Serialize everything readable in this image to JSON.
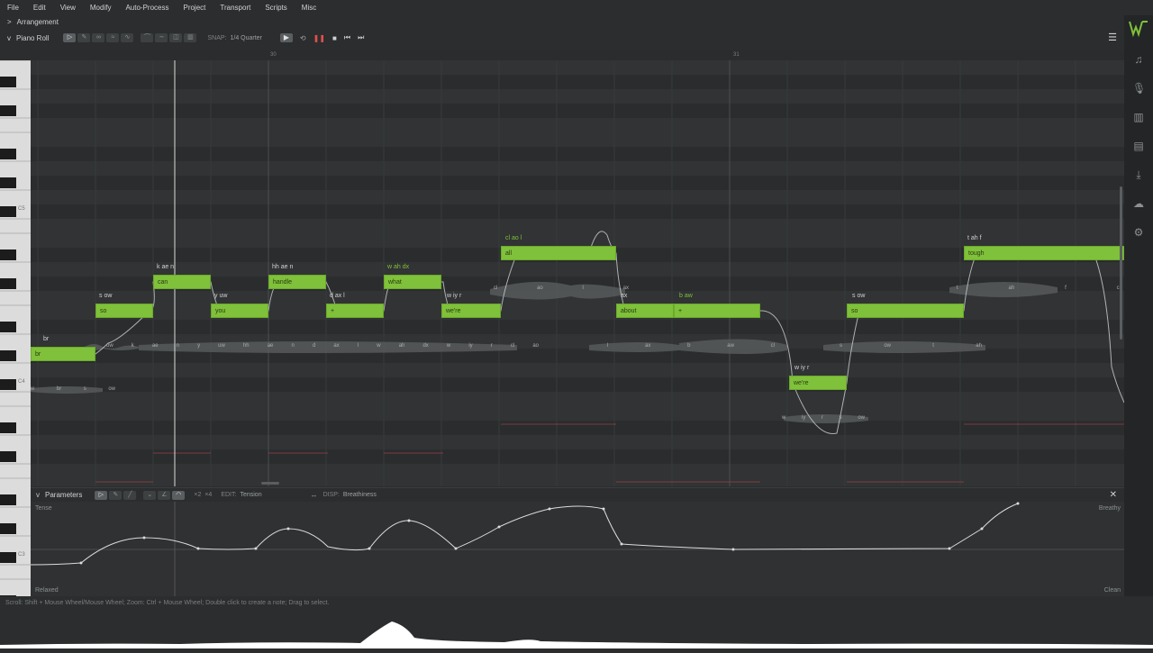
{
  "menu": [
    "File",
    "Edit",
    "View",
    "Modify",
    "Auto-Process",
    "Project",
    "Transport",
    "Scripts",
    "Misc"
  ],
  "arrangement": {
    "label": "Arrangement",
    "chevron": ">"
  },
  "piano_roll": {
    "label": "Piano Roll",
    "chevron": "v",
    "snap_label": "SNAP:",
    "snap_value": "1/4 Quarter",
    "ruler": [
      "30",
      "31"
    ]
  },
  "key_labels": [
    "C5",
    "C4",
    "C3"
  ],
  "notes": [
    {
      "lyric": "br",
      "phon": "br",
      "label": "br"
    },
    {
      "lyric": "so",
      "phon": "s ow",
      "label": "so"
    },
    {
      "lyric": "can",
      "phon": "k ae n",
      "label": "can"
    },
    {
      "lyric": "you",
      "phon": "y uw",
      "label": "you"
    },
    {
      "lyric": "handle",
      "phon": "hh ae n",
      "label": "handle"
    },
    {
      "lyric": "+",
      "phon": "d ax l",
      "label": "+"
    },
    {
      "lyric": "what",
      "phon": "w ah dx",
      "label": "what"
    },
    {
      "lyric": "we're",
      "phon": "w iy r",
      "label": "we're"
    },
    {
      "lyric": "all",
      "phon": "cl ao l",
      "label": "all"
    },
    {
      "lyric": "about",
      "phon": "ax",
      "label": "about"
    },
    {
      "lyric": "+",
      "phon": "b aw",
      "label": "+"
    },
    {
      "lyric": "we're",
      "phon": "w iy r",
      "label": "we're"
    },
    {
      "lyric": "so",
      "phon": "s ow",
      "label": "so"
    },
    {
      "lyric": "tough",
      "phon": "t ah f",
      "label": "tough"
    }
  ],
  "phoneme_rows": {
    "row1": [
      "ow",
      "k",
      "ae",
      "n",
      "y",
      "uw",
      "hh",
      "ae",
      "n",
      "d",
      "ax",
      "l",
      "w",
      "ah",
      "dx",
      "w",
      "iy",
      "r",
      "cl",
      "ao"
    ],
    "row2": [
      "w",
      "br",
      "s",
      "ow"
    ],
    "row3": [
      "cl",
      "ao",
      "l",
      "ax"
    ],
    "row4": [
      "l",
      "ax",
      "b",
      "aw",
      "cl"
    ],
    "row5": [
      "s",
      "ow",
      "t",
      "ah"
    ],
    "row6": [
      "t",
      "ah",
      "f",
      "cl"
    ],
    "row7": [
      "w",
      "iy",
      "r",
      "s",
      "ow"
    ]
  },
  "params": {
    "label": "Parameters",
    "edit_label": "EDIT:",
    "edit_value": "Tension",
    "disp_label": "DISP:",
    "disp_value": "Breathiness",
    "x2": "×2",
    "x4": "×4",
    "top_left": "Tense",
    "bottom_left": "Relaxed",
    "top_right": "Breathy",
    "bottom_right": "Clean"
  },
  "status": "Scroll: Shift + Mouse Wheel/Mouse Wheel; Zoom: Ctrl + Mouse Wheel; Double click to create a note; Drag to select.",
  "colors": {
    "accent": "#7fc13a",
    "bg": "#2f3132"
  }
}
